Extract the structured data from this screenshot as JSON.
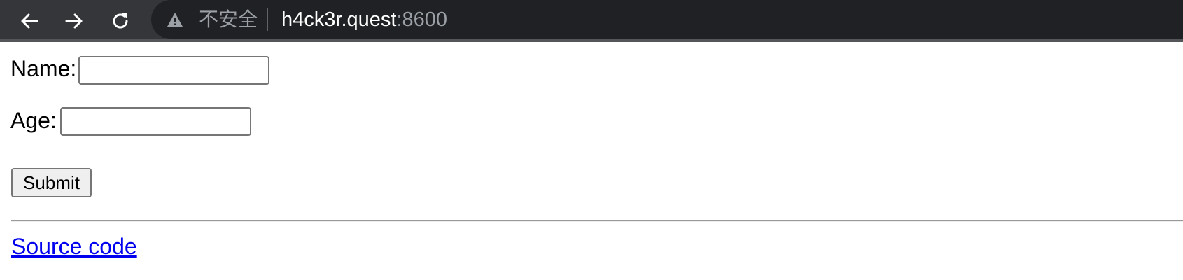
{
  "browser": {
    "back_icon": "arrow-left-icon",
    "forward_icon": "arrow-right-icon",
    "reload_icon": "reload-icon",
    "security_icon": "warning-triangle-icon",
    "security_text": "不安全",
    "url_host": "h4ck3r.quest",
    "url_port": ":8600"
  },
  "form": {
    "name_label": "Name:",
    "name_value": "",
    "age_label": "Age:",
    "age_value": "",
    "submit_label": "Submit"
  },
  "footer": {
    "source_link": "Source code"
  },
  "colors": {
    "toolbar_bg": "#35363a",
    "omnibox_bg": "#202124",
    "link": "#0000ee"
  }
}
